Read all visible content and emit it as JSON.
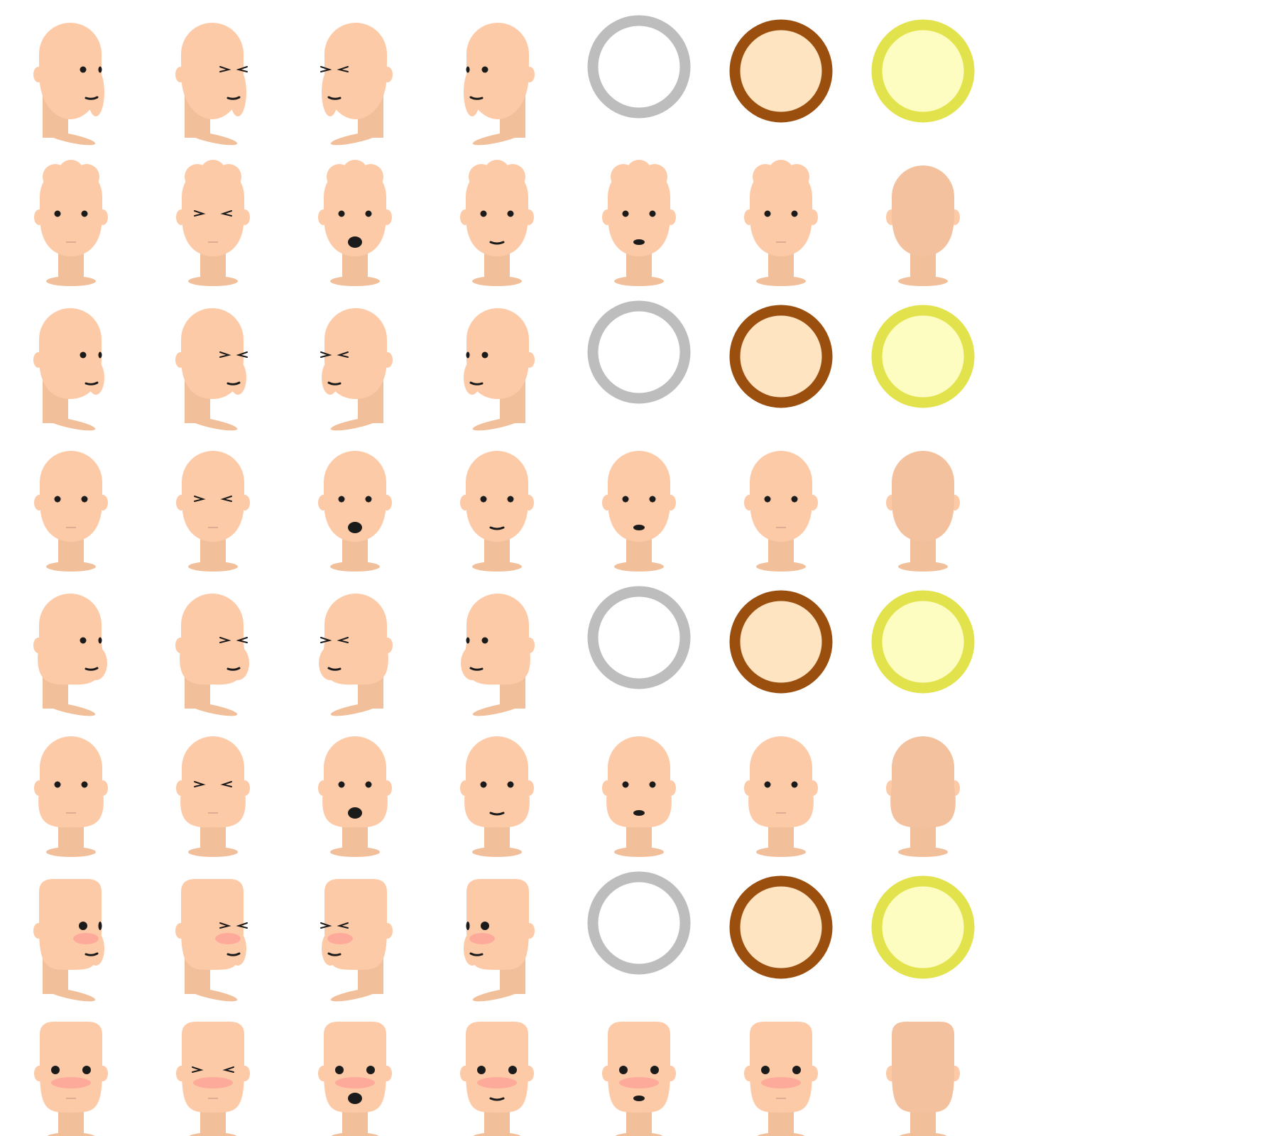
{
  "sprite_sheet": {
    "colors": {
      "skin": "#fdcaa8",
      "skin_shadow": "#f6c19e",
      "neck": "#f2bf9b",
      "back_of_head": "#f4c19e",
      "feature": "#1b1b1b",
      "mouth_line": "#d4a38b",
      "blush": "#ff8f8f",
      "ring_gray": "#bdbdbd",
      "ring_brown": "#9b4f0f",
      "ring_brown_fill": "#ffe4c1",
      "ring_yellow": "#e2e34c",
      "ring_yellow_fill": "#fefdc1"
    },
    "rows": [
      {
        "kind": "side",
        "shape": "long",
        "blush": false,
        "cells": [
          "side-right-neutral",
          "side-right-squint",
          "side-left-squint",
          "side-left-neutral",
          "ring-gray",
          "ring-brown",
          "ring-yellow"
        ]
      },
      {
        "kind": "front",
        "shape": "tufted",
        "blush": false,
        "cells": [
          "neutral",
          "squint",
          "open-mouth",
          "smile",
          "small-open",
          "flat",
          "back-of-head"
        ]
      },
      {
        "kind": "side",
        "shape": "round",
        "blush": false,
        "cells": [
          "side-right-neutral",
          "side-right-squint",
          "side-left-squint",
          "side-left-neutral",
          "ring-gray",
          "ring-brown",
          "ring-yellow"
        ]
      },
      {
        "kind": "front",
        "shape": "round",
        "blush": false,
        "cells": [
          "neutral",
          "squint",
          "open-mouth",
          "smile",
          "small-open",
          "flat",
          "back-of-head"
        ]
      },
      {
        "kind": "side",
        "shape": "chubby",
        "blush": false,
        "cells": [
          "side-right-neutral",
          "side-right-squint",
          "side-left-squint",
          "side-left-neutral",
          "ring-gray",
          "ring-brown",
          "ring-yellow"
        ]
      },
      {
        "kind": "front",
        "shape": "chubby",
        "blush": false,
        "cells": [
          "neutral",
          "squint",
          "open-mouth",
          "smile",
          "small-open",
          "flat",
          "back-of-head"
        ]
      },
      {
        "kind": "side",
        "shape": "square",
        "blush": true,
        "cells": [
          "side-right-neutral",
          "side-right-squint",
          "side-left-squint",
          "side-left-neutral",
          "ring-gray",
          "ring-brown",
          "ring-yellow"
        ]
      },
      {
        "kind": "front",
        "shape": "square",
        "blush": true,
        "cells": [
          "neutral",
          "squint",
          "open-mouth",
          "smile",
          "small-open",
          "flat",
          "back-of-head"
        ]
      }
    ]
  }
}
